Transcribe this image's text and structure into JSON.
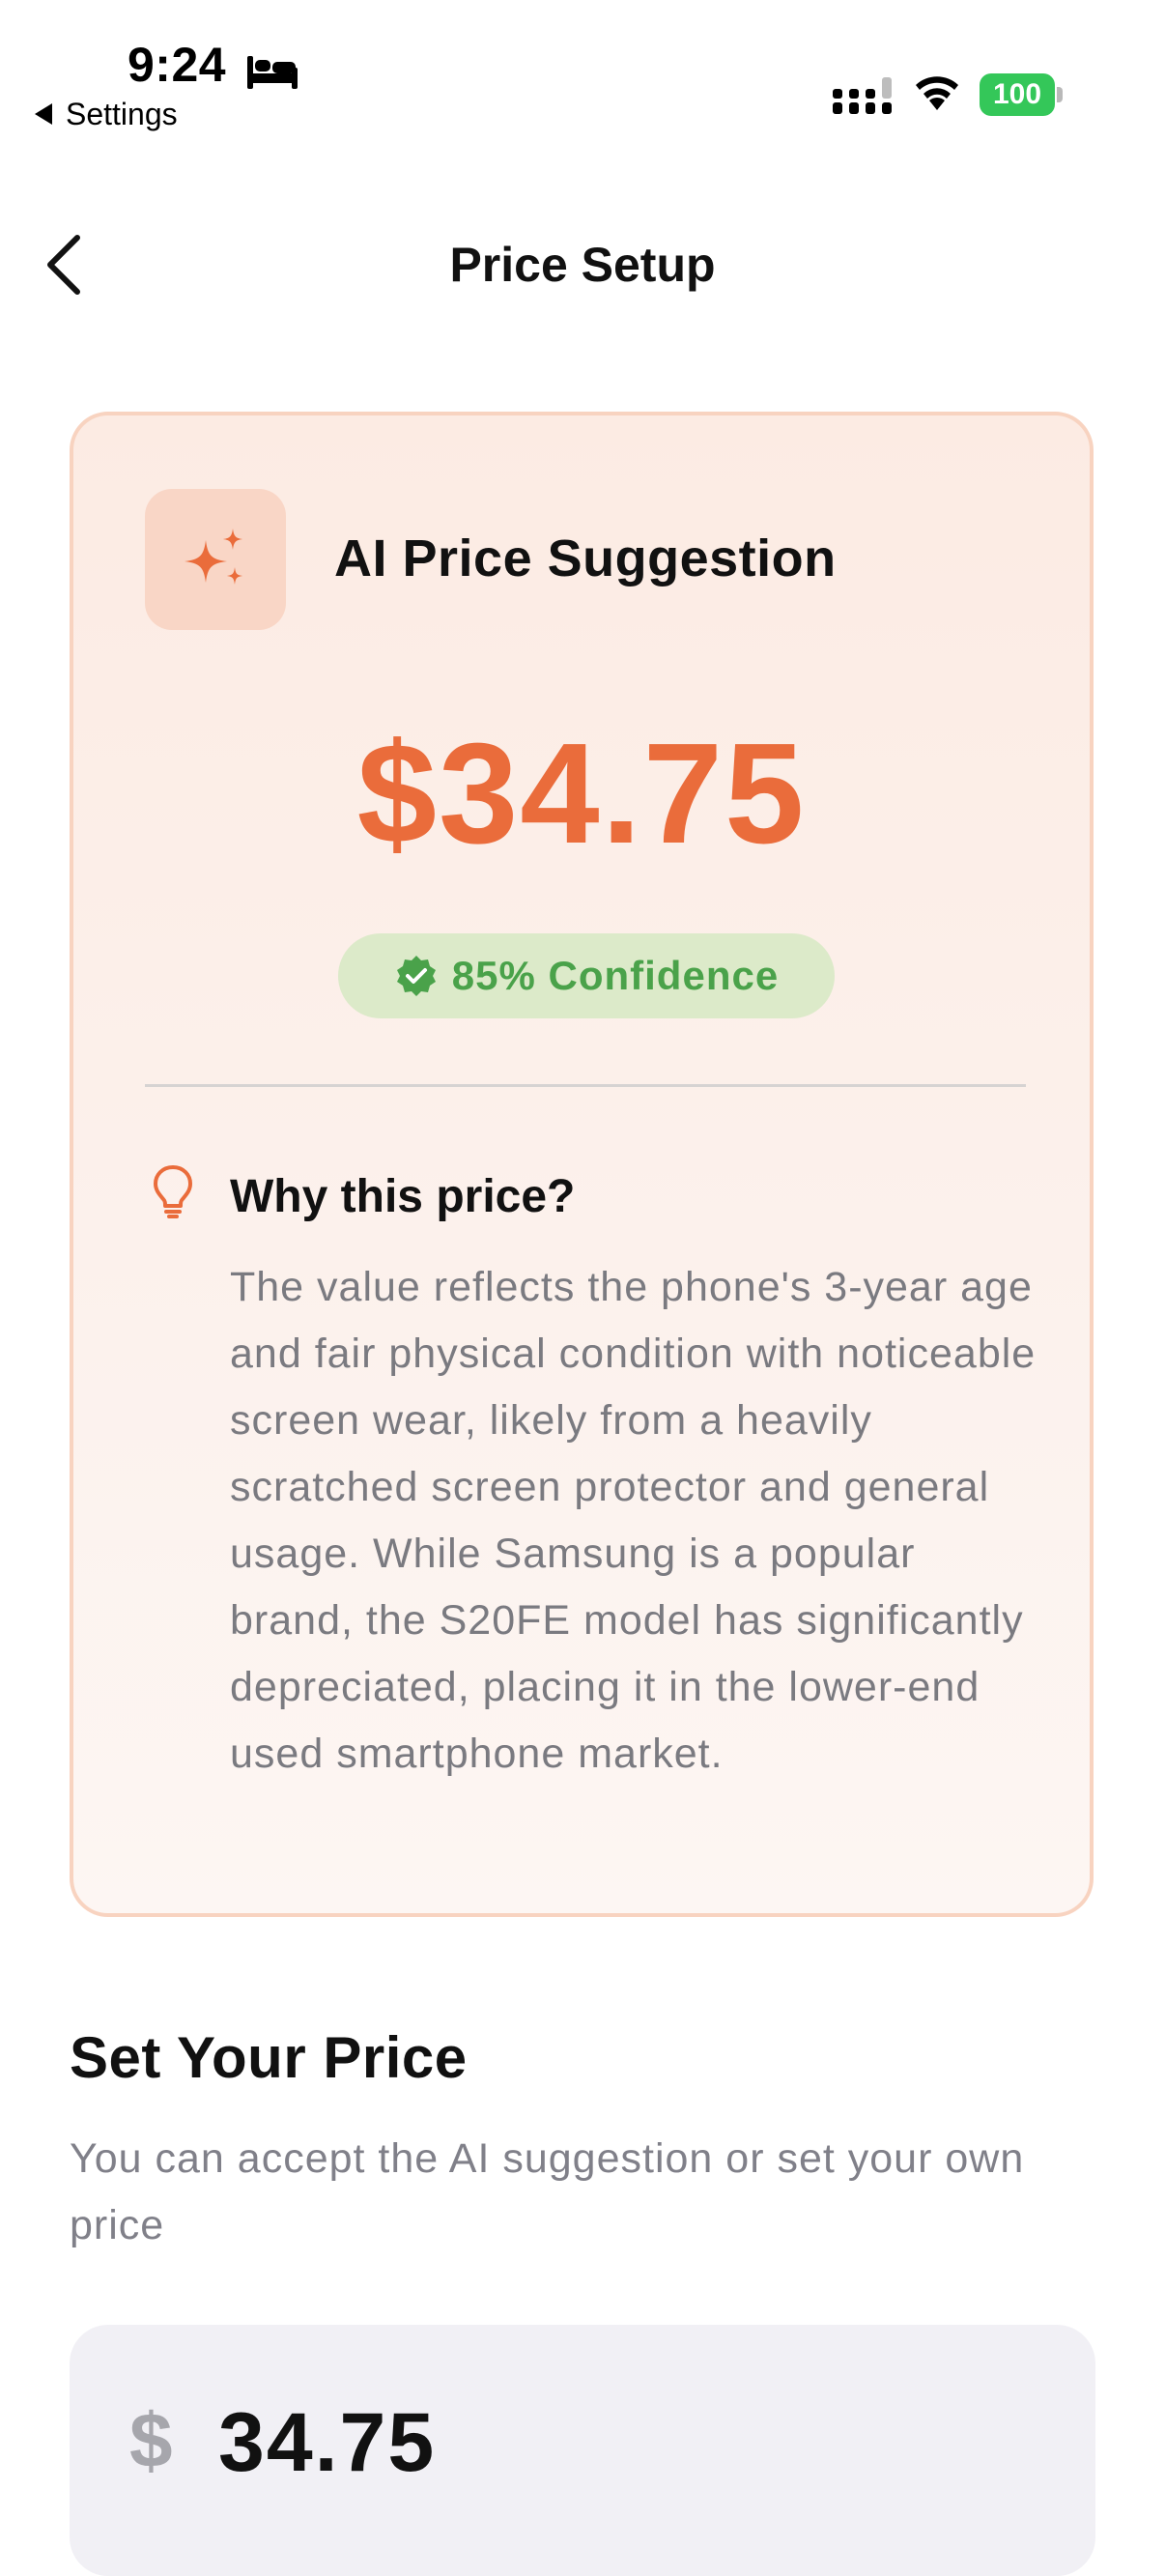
{
  "status_bar": {
    "time": "9:24",
    "back_app": "Settings",
    "battery": "100",
    "icons": [
      "bed-icon",
      "signal-icon",
      "wifi-icon",
      "battery-icon"
    ]
  },
  "nav": {
    "title": "Price Setup",
    "back_icon": "chevron-left-icon"
  },
  "ai_card": {
    "icon": "sparkles-icon",
    "title": "AI Price Suggestion",
    "price": "$34.75",
    "confidence": "85% Confidence",
    "why_icon": "lightbulb-icon",
    "why_title": "Why this price?",
    "why_body": "The value reflects the phone's 3-year age and fair physical condition with noticeable screen wear, likely from a heavily scratched screen protector and general usage. While Samsung is a popular brand, the S20FE model has significantly depreciated, placing it in the lower-end used smartphone market."
  },
  "set_price": {
    "title": "Set Your Price",
    "subtitle": "You can accept the AI suggestion or set your own price",
    "currency": "$",
    "value": "34.75"
  },
  "colors": {
    "accent": "#ea6c3b",
    "card_border": "#f8d3c0",
    "confidence_bg": "#dceac9",
    "confidence_text": "#4aa24a",
    "battery": "#34c759",
    "input_bg": "#f1f0f5"
  }
}
